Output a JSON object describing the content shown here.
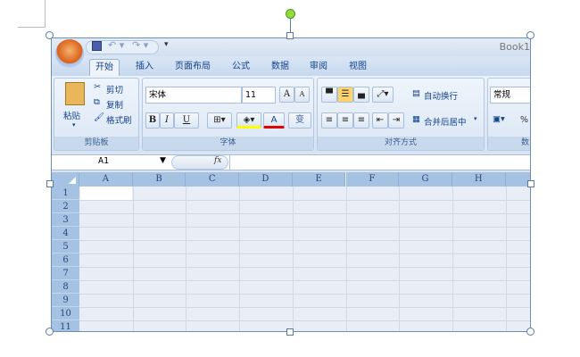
{
  "title": "Book1",
  "quick_access": {
    "save_icon": "save-icon",
    "undo_icon": "undo-icon",
    "redo_icon": "redo-icon",
    "customize_icon": "dropdown-icon"
  },
  "tabs": [
    "开始",
    "插入",
    "页面布局",
    "公式",
    "数据",
    "审阅",
    "视图"
  ],
  "active_tab": "开始",
  "clipboard": {
    "paste": "粘贴",
    "cut": "剪切",
    "copy": "复制",
    "format_painter": "格式刷",
    "label": "剪贴板"
  },
  "font": {
    "name": "宋体",
    "size": "11",
    "grow": "A",
    "shrink": "A",
    "bold": "B",
    "italic": "I",
    "underline": "U",
    "font_color": "A",
    "phonetic": "变",
    "label": "字体",
    "fill_color": "#ffff00",
    "text_color": "#e00000"
  },
  "alignment": {
    "wrap_text": "自动换行",
    "merge_center": "合并后居中",
    "label": "对齐方式"
  },
  "number": {
    "format": "常规",
    "percent": "%",
    "label": "数"
  },
  "formula_bar": {
    "name_box": "A1",
    "fx": "fx",
    "value": ""
  },
  "columns": [
    "A",
    "B",
    "C",
    "D",
    "E",
    "F",
    "G",
    "H"
  ],
  "rows": [
    "1",
    "2",
    "3",
    "4",
    "5",
    "6",
    "7",
    "8",
    "9",
    "10",
    "11"
  ]
}
